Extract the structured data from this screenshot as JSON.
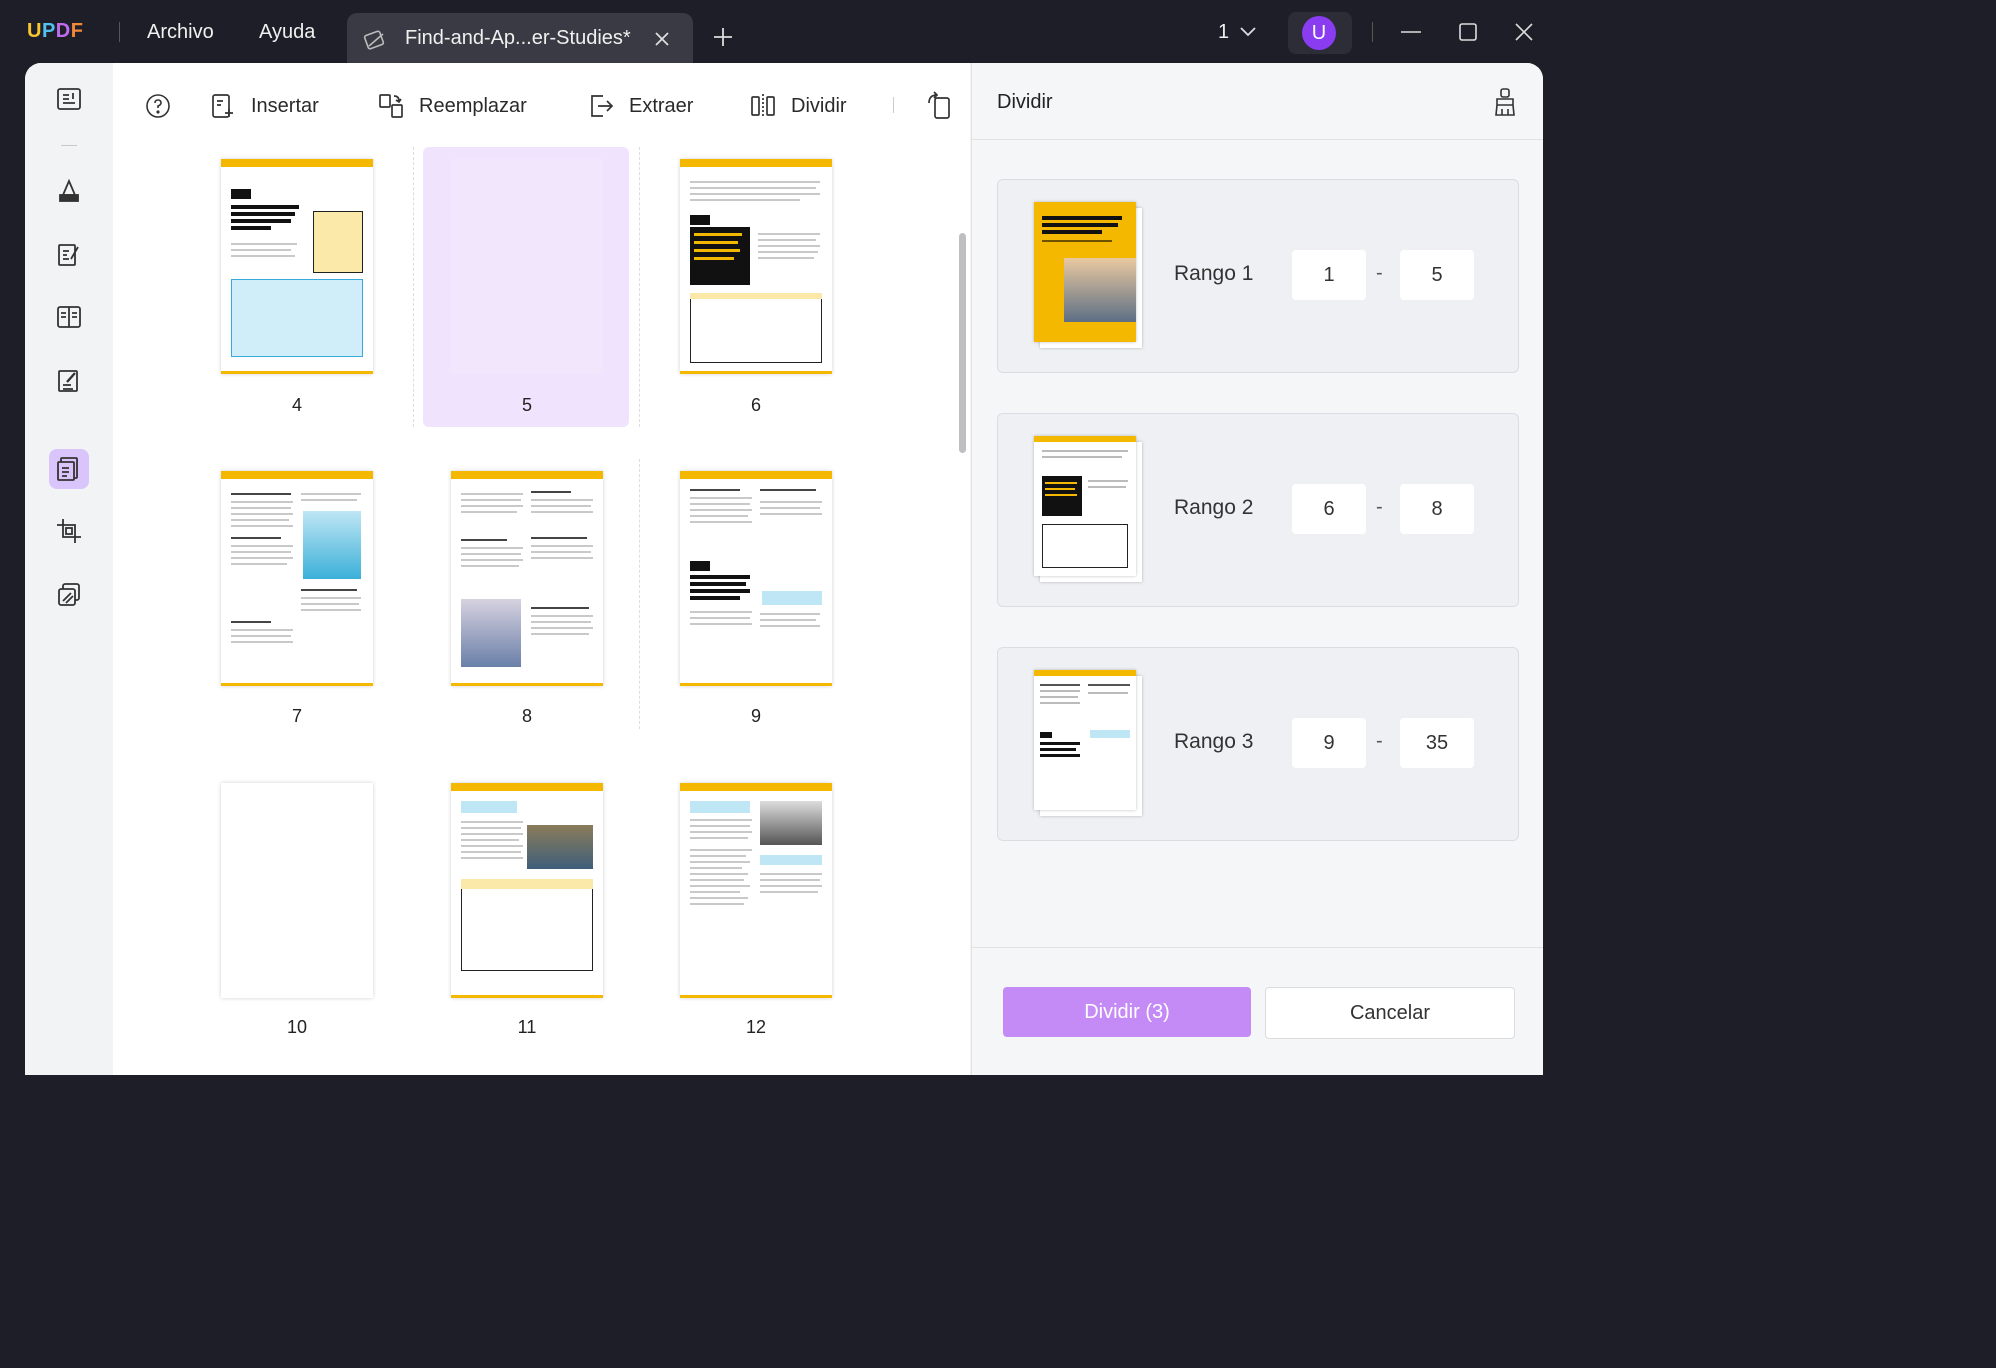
{
  "app": {
    "logo": {
      "u": "U",
      "p": "P",
      "d": "D",
      "f": "F"
    },
    "menu": [
      "Archivo",
      "Ayuda"
    ],
    "tab_title": "Find-and-Ap...er-Studies*",
    "page_count": "1",
    "avatar_letter": "U"
  },
  "colors": {
    "accent": "#c48af6",
    "selected": "#efe3fd",
    "brand_yellow": "#f5b800"
  },
  "toolbar": {
    "insert": "Insertar",
    "replace": "Reemplazar",
    "extract": "Extraer",
    "split": "Dividir"
  },
  "pages": [
    {
      "num": "4",
      "kind": "title-table",
      "heading": "The 10 Best Global Universities Leading the World Education",
      "badge": "02"
    },
    {
      "num": "5",
      "kind": "blank-selected",
      "heading": "",
      "badge": ""
    },
    {
      "num": "6",
      "kind": "black-box",
      "heading": "Looking Into the Top 10 Subject Majors That Feature the Best Professional Exposure",
      "badge": "03"
    },
    {
      "num": "7",
      "kind": "text-photo",
      "heading": "Health and Medical Preparator",
      "badge": ""
    },
    {
      "num": "8",
      "kind": "text-photo-left",
      "heading": "Applied Mathematics",
      "badge": ""
    },
    {
      "num": "9",
      "kind": "text-heading",
      "heading": "Scholarship Rules - An Overview and How to Apply For One In Your Favorite Institution",
      "badge": "04"
    },
    {
      "num": "10",
      "kind": "blank",
      "heading": "",
      "badge": ""
    },
    {
      "num": "11",
      "kind": "photo-table",
      "heading": "",
      "badge": ""
    },
    {
      "num": "12",
      "kind": "text-photo-right",
      "heading": "",
      "badge": ""
    }
  ],
  "panel": {
    "title": "Dividir",
    "ranges": [
      {
        "label": "Rango 1",
        "from": "1",
        "to": "5"
      },
      {
        "label": "Rango 2",
        "from": "6",
        "to": "8"
      },
      {
        "label": "Rango 3",
        "from": "9",
        "to": "35"
      }
    ],
    "dash": "-",
    "split_button": "Dividir (3)",
    "cancel_button": "Cancelar"
  }
}
